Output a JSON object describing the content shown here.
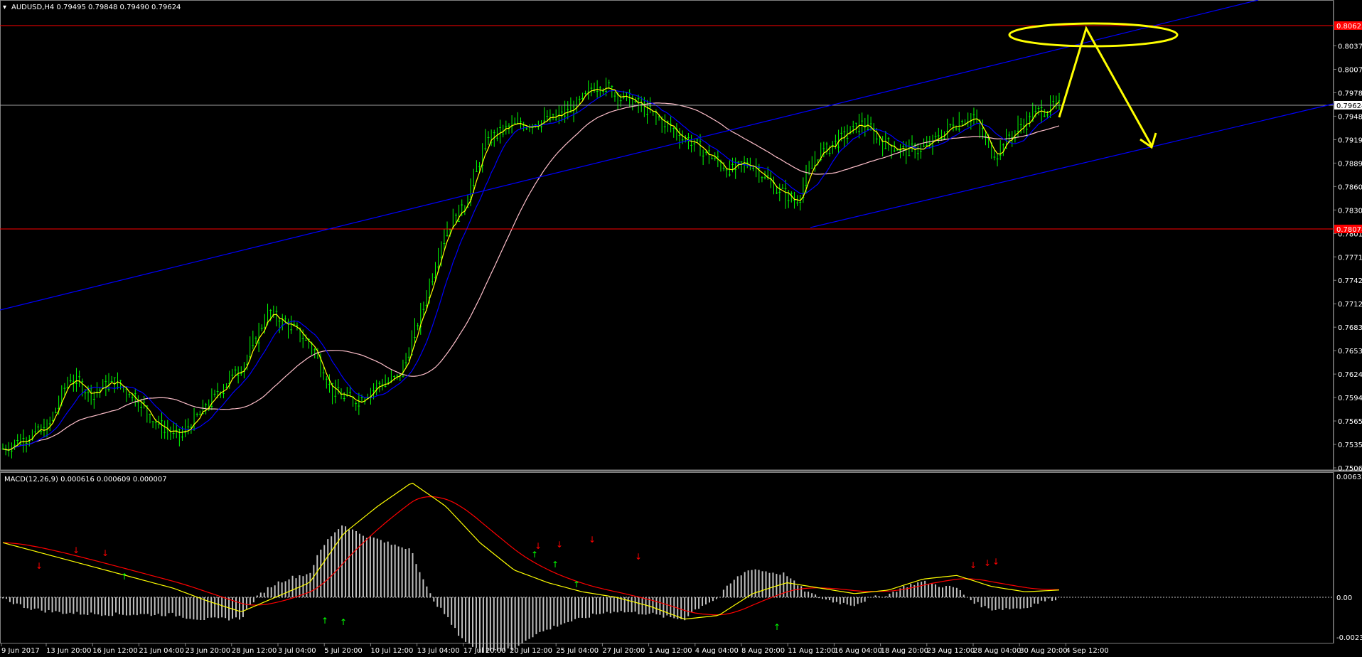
{
  "window": {
    "symbol_info": "AUDUSD,H4  0.79495 0.79848 0.79490 0.79624",
    "macd_info": "MACD(12,26,9) 0.000616 0.000609 0.000007"
  },
  "colors": {
    "background": "#000000",
    "candles": "#00ff00",
    "fast_ma": "#ffff00",
    "mid_ma": "#0000ff",
    "slow_ma": "#ffc0cb",
    "horizontal_levels": "#ff0000",
    "channel": "#0000ff",
    "annotation": "#ffff00",
    "macd_hist": "#c0c0c0",
    "macd_line": "#ffff00",
    "signal_line": "#ff0000"
  },
  "price_axis": {
    "labels": [
      "0.80370",
      "0.80075",
      "0.79780",
      "0.79485",
      "0.79190",
      "0.78895",
      "0.78600",
      "0.78305",
      "0.78010",
      "0.77715",
      "0.77420",
      "0.77125",
      "0.76830",
      "0.76535",
      "0.76240",
      "0.75945",
      "0.75650",
      "0.75355",
      "0.75060"
    ],
    "current_price_tag": "0.79624",
    "resistance_tag": "0.80625",
    "support_tag": "0.78078",
    "tag_color": "#ff0000"
  },
  "macd_axis": {
    "labels": [
      "0.006328",
      "0.00",
      "-0.002327"
    ]
  },
  "time_axis": {
    "labels": [
      "9 Jun 2017",
      "13 Jun 20:00",
      "16 Jun 12:00",
      "21 Jun 04:00",
      "23 Jun 20:00",
      "28 Jun 12:00",
      "3 Jul 04:00",
      "5 Jul 20:00",
      "10 Jul 12:00",
      "13 Jul 04:00",
      "17 Jul 20:00",
      "20 Jul 12:00",
      "25 Jul 04:00",
      "27 Jul 20:00",
      "1 Aug 12:00",
      "4 Aug 04:00",
      "8 Aug 20:00",
      "11 Aug 12:00",
      "16 Aug 04:00",
      "18 Aug 20:00",
      "23 Aug 12:00",
      "28 Aug 04:00",
      "30 Aug 20:00",
      "4 Sep 12:00"
    ]
  },
  "chart_data": {
    "type": "candlestick",
    "symbol": "AUDUSD",
    "timeframe": "H4",
    "close_path": [
      0.753,
      0.7545,
      0.7555,
      0.762,
      0.76,
      0.7615,
      0.7595,
      0.756,
      0.7545,
      0.7575,
      0.761,
      0.764,
      0.77,
      0.7685,
      0.766,
      0.76,
      0.759,
      0.761,
      0.762,
      0.77,
      0.78,
      0.784,
      0.792,
      0.7935,
      0.794,
      0.7945,
      0.796,
      0.799,
      0.7975,
      0.796,
      0.794,
      0.792,
      0.79,
      0.788,
      0.789,
      0.786,
      0.784,
      0.79,
      0.792,
      0.794,
      0.7915,
      0.7905,
      0.791,
      0.7935,
      0.795,
      0.79,
      0.793,
      0.7955,
      0.7962
    ],
    "resistance": 0.80625,
    "support": 0.78078,
    "current": 0.79624,
    "macd_path": [
      0.003,
      0.0025,
      0.002,
      0.0015,
      0.001,
      0.0005,
      -0.0002,
      -0.0008,
      0.0,
      0.0008,
      0.0035,
      0.005,
      0.0063,
      0.005,
      0.003,
      0.0015,
      0.0008,
      0.0003,
      0.0,
      -0.0005,
      -0.0012,
      -0.001,
      0.0002,
      0.0008,
      0.0005,
      0.0002,
      0.0004,
      0.001,
      0.0012,
      0.0006,
      0.0003,
      0.0004
    ]
  }
}
